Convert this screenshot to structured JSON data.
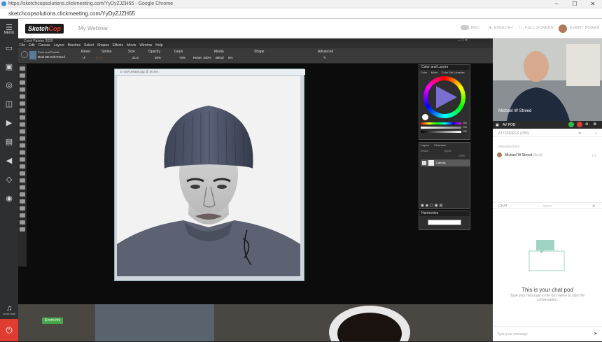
{
  "browser": {
    "title": "https://sketchcopsolutions.clickmeeting.com/YyDyZJZH65 - Google Chrome",
    "url": "sketchcopsolutions.clickmeeting.com/YyDyZJZH65",
    "min": "–",
    "max": "☐",
    "close": "✕"
  },
  "rail": {
    "menu_label": "MENU",
    "lunch_label": "Lunch talk"
  },
  "topbar": {
    "logo_a": "Sketch",
    "logo_b": "Cop",
    "webinar_title": "My Webinar",
    "rec": "REC",
    "language": "ENGLISH",
    "fullscreen": "FULL SCREEN",
    "event_board": "EVENT BOARD"
  },
  "painter": {
    "title": "Corel Painter 2020",
    "menus": [
      "File",
      "Edit",
      "Canvas",
      "Layers",
      "Brushes",
      "Select",
      "Shapes",
      "Effects",
      "Movie",
      "Window",
      "Help"
    ],
    "brush_category": "Pens and Pencils",
    "brush_variant": "Real 6B Soft Pencil",
    "props": {
      "reset": "Reset",
      "stroke": "Stroke",
      "size": "Size",
      "size_val": "21.6",
      "opacity": "Opacity",
      "opacity_val": "30%",
      "grain": "Grain",
      "grain_val": "70%",
      "media": "Media",
      "media_reset": "Reset",
      "media_val": "100%",
      "blend": "Blend",
      "blend_val": "0%",
      "shape": "Shape",
      "advanced": "Advanced"
    },
    "document_title": "D-197199359.jpg @ 40.6%",
    "color_panel_title": "Color and Layers",
    "color_tabs": [
      "Color",
      "Mixer",
      "Color Set Libraries"
    ],
    "layers_tabs": [
      "Layers",
      "Channels"
    ],
    "layers_default": "Default",
    "layers_ignore": "Ignore",
    "opacity_pct": "100%",
    "layer_name": "Canvas",
    "harmonies_title": "Harmonies",
    "color_hue_deg": 0,
    "sliders": [
      "255",
      "255",
      "255"
    ]
  },
  "stage": {
    "event_info": "Event info"
  },
  "side": {
    "presenter_name": "Michael W Streed",
    "av_pod": "AV POD",
    "attendees": "ATTENDEES (0/50)",
    "presenters": "PRESENTERS",
    "presenter_entry": "Michael W Streed",
    "presenter_role": "(host)",
    "chat": "CHAT",
    "chat_empty_title": "This is your chat pod",
    "chat_empty_desc": "Type your message in the box below to start the conversation.",
    "chat_placeholder": "Type your message"
  }
}
